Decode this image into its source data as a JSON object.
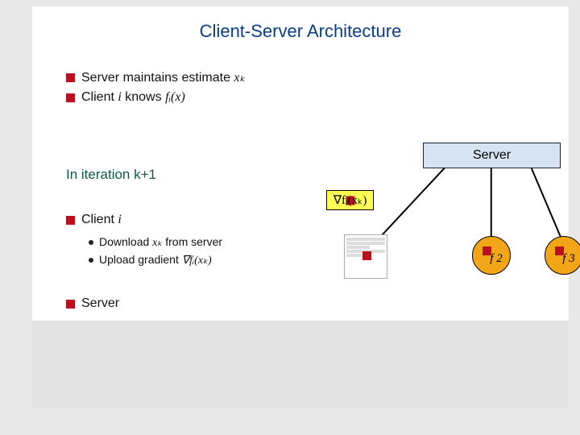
{
  "title": "Client-Server Architecture",
  "bullets": {
    "b1_prefix": "Server maintains estimate ",
    "b1_math": "xₖ",
    "b2_prefix": "Client ",
    "b2_i": "i",
    "b2_mid": " knows ",
    "b2_math": "fᵢ(x)",
    "iter": "In iteration k+1",
    "b3_prefix": "Client ",
    "b3_i": "i",
    "sub1_prefix": "Download ",
    "sub1_math": "xₖ",
    "sub1_suffix": " from server",
    "sub2_prefix": "Upload gradient ",
    "sub2_math": "∇fᵢ(xₖ)",
    "b4": "Server"
  },
  "server_label": "Server",
  "grad_label": "∇fᵢ(xₖ)",
  "clients": {
    "c2": "f 2",
    "c3": "f 3"
  }
}
